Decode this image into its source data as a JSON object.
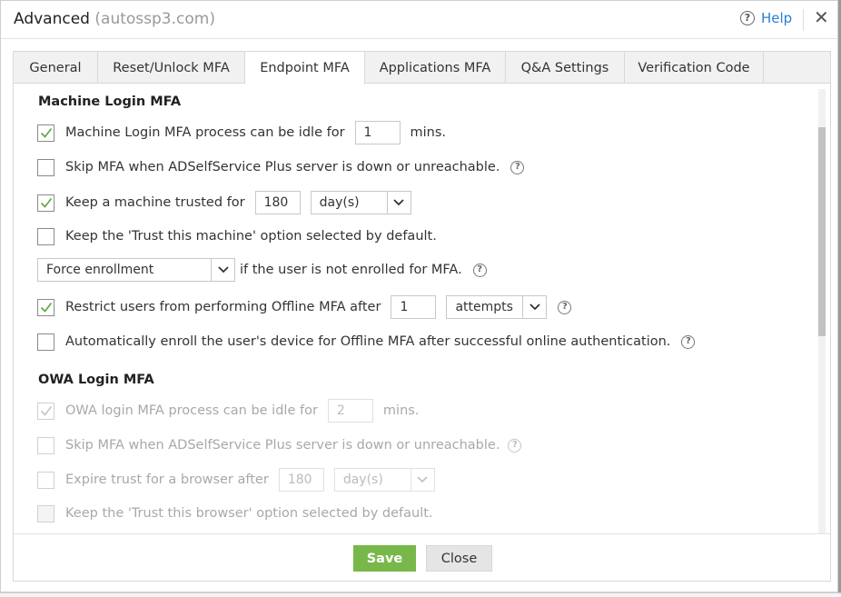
{
  "dialog": {
    "title": "Advanced",
    "domain": "(autossp3.com)",
    "help_label": "Help"
  },
  "tabs": [
    "General",
    "Reset/Unlock MFA",
    "Endpoint MFA",
    "Applications MFA",
    "Q&A Settings",
    "Verification Code"
  ],
  "active_tab": "Endpoint MFA",
  "machine": {
    "heading": "Machine Login MFA",
    "idle_label": "Machine Login MFA process can be idle for",
    "idle_value": "1",
    "idle_unit": "mins.",
    "skip_label": "Skip MFA when ADSelfService Plus server is down or unreachable.",
    "trust_label": "Keep a machine trusted for",
    "trust_value": "180",
    "trust_unit": "day(s)",
    "trust_default_label": "Keep the 'Trust this machine' option selected by default.",
    "enroll_select": "Force enrollment",
    "enroll_label": "if the user is not enrolled for MFA.",
    "restrict_label": "Restrict users from performing Offline MFA after",
    "restrict_value": "1",
    "restrict_unit": "attempts",
    "auto_enroll_label": "Automatically enroll the user's device for Offline MFA after successful online authentication."
  },
  "owa": {
    "heading": "OWA Login MFA",
    "idle_label": "OWA login MFA process can be idle for",
    "idle_value": "2",
    "idle_unit": "mins.",
    "skip_label": "Skip MFA when ADSelfService Plus server is down or unreachable.",
    "expire_label": "Expire trust for a browser after",
    "expire_value": "180",
    "expire_unit": "day(s)",
    "trust_default_label": "Keep the 'Trust this browser' option selected by default."
  },
  "buttons": {
    "save": "Save",
    "close": "Close"
  },
  "icons": {
    "help": "?",
    "question": "?",
    "close": "✕"
  },
  "colors": {
    "accent": "#2a7fd4",
    "save": "#78b84a",
    "check": "#5aa546"
  }
}
